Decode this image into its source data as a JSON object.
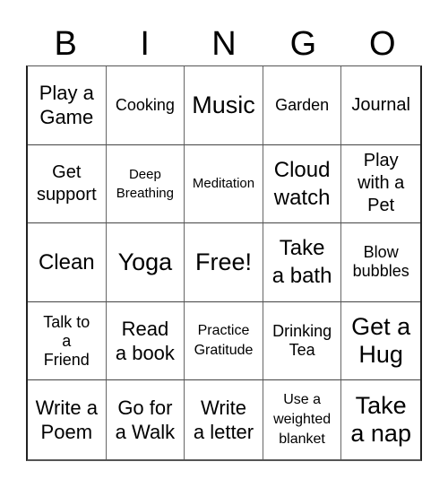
{
  "header": {
    "letters": [
      "B",
      "I",
      "N",
      "G",
      "O"
    ]
  },
  "grid": {
    "cells": [
      {
        "text": "Play a\nGame",
        "size": "s-md"
      },
      {
        "text": "Cooking",
        "size": "s-xs"
      },
      {
        "text": "Music",
        "size": "s-xl"
      },
      {
        "text": "Garden",
        "size": "s-xs"
      },
      {
        "text": "Journal",
        "size": "s-sm"
      },
      {
        "text": "Get\nsupport",
        "size": "s-sm"
      },
      {
        "text": "Deep\nBreathing",
        "size": "s-tiny"
      },
      {
        "text": "Meditation",
        "size": "s-tiny"
      },
      {
        "text": "Cloud\nwatch",
        "size": "s-lg"
      },
      {
        "text": "Play\nwith a\nPet",
        "size": "s-sm"
      },
      {
        "text": "Clean",
        "size": "s-lg"
      },
      {
        "text": "Yoga",
        "size": "s-xl"
      },
      {
        "text": "Free!",
        "size": "s-xl"
      },
      {
        "text": "Take\na bath",
        "size": "s-lg"
      },
      {
        "text": "Blow\nbubbles",
        "size": "s-xs"
      },
      {
        "text": "Talk to\na\nFriend",
        "size": "s-xs"
      },
      {
        "text": "Read\na book",
        "size": "s-md"
      },
      {
        "text": "Practice\nGratitude",
        "size": "s-micro"
      },
      {
        "text": "Drinking\nTea",
        "size": "s-xs"
      },
      {
        "text": "Get a\nHug",
        "size": "s-xl"
      },
      {
        "text": "Write a\nPoem",
        "size": "s-md"
      },
      {
        "text": "Go for\na Walk",
        "size": "s-md"
      },
      {
        "text": "Write\na letter",
        "size": "s-md"
      },
      {
        "text": "Use a\nweighted\nblanket",
        "size": "s-xxs"
      },
      {
        "text": "Take\na nap",
        "size": "s-xl"
      }
    ]
  }
}
